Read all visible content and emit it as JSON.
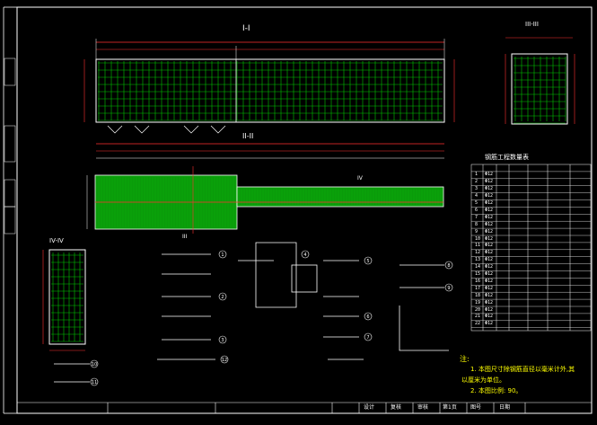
{
  "colors": {
    "background": "#000000",
    "reinforcement": "#00c800",
    "dimension": "#ff3030",
    "border": "#ffffff",
    "note_text": "#ffff00",
    "label_text": "#ffffff"
  },
  "section_labels": {
    "elevation": "I-I",
    "cross_section_right": "III-III",
    "plan": "II-II",
    "cross_section_left": "IV-IV",
    "marker_iii": "III",
    "marker_iv": "IV"
  },
  "table": {
    "title": "钢筋工程数量表",
    "rows": [
      [
        "1",
        "Φ12",
        "",
        ""
      ],
      [
        "2",
        "Φ12",
        "",
        ""
      ],
      [
        "3",
        "Φ12",
        "",
        ""
      ],
      [
        "4",
        "Φ12",
        "",
        ""
      ],
      [
        "5",
        "Φ12",
        "",
        ""
      ],
      [
        "6",
        "Φ12",
        "",
        ""
      ],
      [
        "7",
        "Φ12",
        "",
        ""
      ],
      [
        "8",
        "Φ12",
        "",
        ""
      ],
      [
        "9",
        "Φ12",
        "",
        ""
      ],
      [
        "10",
        "Φ12",
        "",
        ""
      ],
      [
        "11",
        "Φ12",
        "",
        ""
      ],
      [
        "12",
        "Φ12",
        "",
        ""
      ],
      [
        "13",
        "Φ12",
        "",
        ""
      ],
      [
        "14",
        "Φ12",
        "",
        ""
      ],
      [
        "15",
        "Φ12",
        "",
        ""
      ],
      [
        "16",
        "Φ12",
        "",
        ""
      ],
      [
        "17",
        "Φ12",
        "",
        ""
      ],
      [
        "18",
        "Φ12",
        "",
        ""
      ],
      [
        "19",
        "Φ12",
        "",
        ""
      ],
      [
        "20",
        "Φ12",
        "",
        ""
      ],
      [
        "21",
        "Φ12",
        "",
        ""
      ],
      [
        "22",
        "Φ12",
        "",
        ""
      ]
    ]
  },
  "notes": {
    "heading": "注:",
    "line1": "1. 本图尺寸除钢筋直径以毫米计外,其",
    "line1b": "以厘米为单位。",
    "line2": "2. 本图比例: 90。"
  },
  "bar_marks": [
    "1",
    "2",
    "3",
    "4",
    "5",
    "6",
    "7",
    "8",
    "9",
    "10",
    "11",
    "12"
  ],
  "title_block": {
    "project": "",
    "drawing": "",
    "c1": "设计",
    "c2": "复核",
    "c3": "审核",
    "c4": "第1页",
    "c5": "图号",
    "c6": "日期"
  }
}
